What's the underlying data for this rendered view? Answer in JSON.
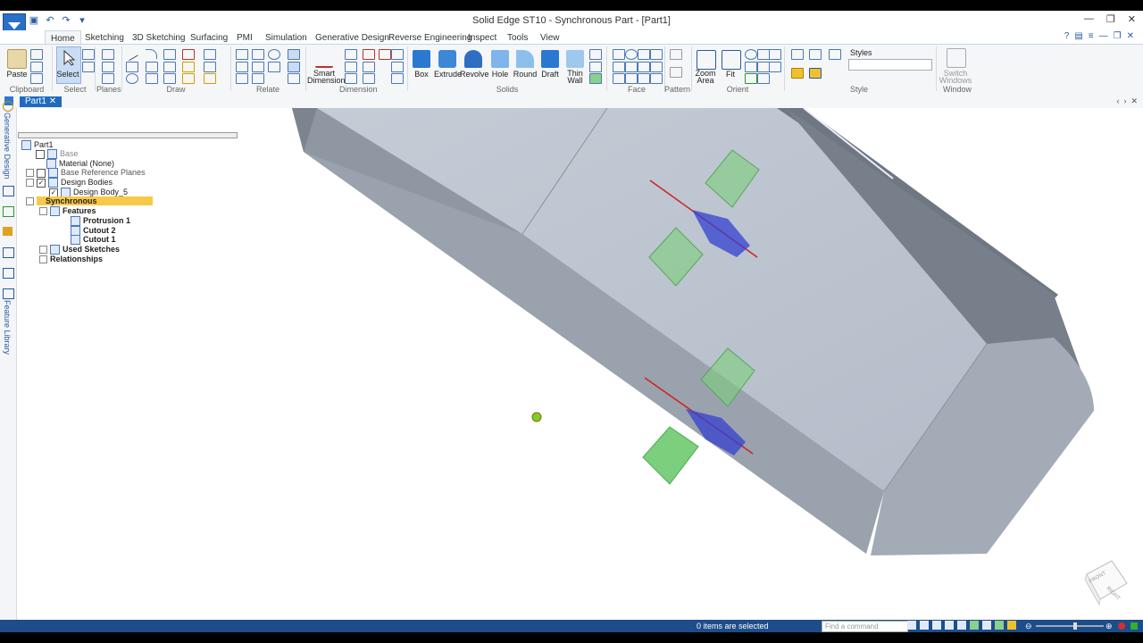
{
  "title": "Solid Edge ST10 - Synchronous Part - [Part1]",
  "tabs": [
    "Home",
    "Sketching",
    "3D Sketching",
    "Surfacing",
    "PMI",
    "Simulation",
    "Generative Design",
    "Reverse Engineering",
    "Inspect",
    "Tools",
    "View"
  ],
  "ribbon": {
    "buttons": {
      "paste": "Paste",
      "select": "Select",
      "smart_dimension_1": "Smart",
      "smart_dimension_2": "Dimension",
      "box": "Box",
      "extrude": "Extrude",
      "revolve": "Revolve",
      "hole": "Hole",
      "round": "Round",
      "draft": "Draft",
      "thin_wall_1": "Thin",
      "thin_wall_2": "Wall",
      "zoom_area_1": "Zoom",
      "zoom_area_2": "Area",
      "fit": "Fit",
      "styles": "Styles",
      "switch_windows_1": "Switch",
      "switch_windows_2": "Windows"
    },
    "groups": {
      "clipboard": "Clipboard",
      "select": "Select",
      "planes": "Planes",
      "draw": "Draw",
      "relate": "Relate",
      "dimension": "Dimension",
      "solids": "Solids",
      "face_relate": "Face Relate",
      "pattern": "Pattern",
      "orient": "Orient",
      "style": "Style",
      "window": "Window"
    }
  },
  "doc_tab": "Part1",
  "side_labels": {
    "generative": "Generative Design",
    "library": "Feature Library"
  },
  "tree": {
    "root": "Part1",
    "base": "Base",
    "material": "Material (None)",
    "base_planes": "Base Reference Planes",
    "design_bodies": "Design Bodies",
    "design_body": "Design Body_5",
    "synchronous": "Synchronous",
    "features": "Features",
    "protrusion": "Protrusion 1",
    "cutout2": "Cutout 2",
    "cutout1": "Cutout 1",
    "used_sketches": "Used Sketches",
    "relationships": "Relationships"
  },
  "view_cube": {
    "front": "FRONT",
    "right": "RIGHT"
  },
  "status": {
    "selection": "0 items are selected",
    "find_placeholder": "Find a command"
  },
  "colors": {
    "accent": "#1f6bc2",
    "status_bar": "#1e4d8a",
    "synchronous_highlight": "#f7c948",
    "face_green": "#7ccf7c",
    "steering_blue": "#3340d0",
    "axis_red": "#d02020"
  }
}
